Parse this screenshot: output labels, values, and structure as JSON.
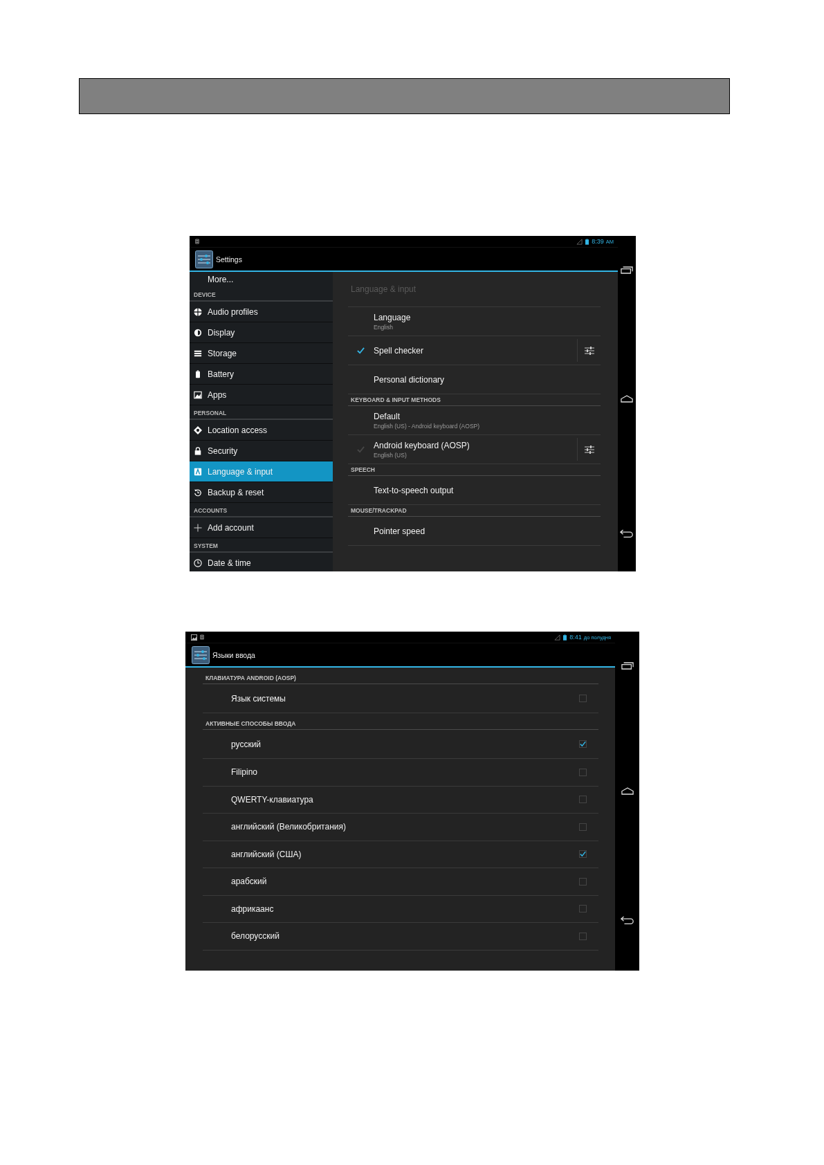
{
  "settings_screen": {
    "status_bar": {
      "time": "8:39",
      "meridiem": "AM"
    },
    "action_bar": {
      "title": "Settings"
    },
    "sidebar": {
      "items": [
        {
          "kind": "item",
          "label": "More...",
          "selected": false
        },
        {
          "kind": "header",
          "label": "DEVICE"
        },
        {
          "kind": "item",
          "label": "Audio profiles",
          "selected": false
        },
        {
          "kind": "item",
          "label": "Display",
          "selected": false
        },
        {
          "kind": "item",
          "label": "Storage",
          "selected": false
        },
        {
          "kind": "item",
          "label": "Battery",
          "selected": false
        },
        {
          "kind": "item",
          "label": "Apps",
          "selected": false
        },
        {
          "kind": "header",
          "label": "PERSONAL"
        },
        {
          "kind": "item",
          "label": "Location access",
          "selected": false
        },
        {
          "kind": "item",
          "label": "Security",
          "selected": false
        },
        {
          "kind": "item",
          "label": "Language & input",
          "selected": true
        },
        {
          "kind": "item",
          "label": "Backup & reset",
          "selected": false
        },
        {
          "kind": "header",
          "label": "ACCOUNTS"
        },
        {
          "kind": "item",
          "label": "Add account",
          "selected": false
        },
        {
          "kind": "header",
          "label": "SYSTEM"
        },
        {
          "kind": "item",
          "label": "Date & time",
          "selected": false
        }
      ]
    },
    "detail": {
      "title": "Language & input",
      "items": [
        {
          "kind": "row",
          "title": "Language",
          "summary": "English"
        },
        {
          "kind": "check",
          "title": "Spell checker",
          "checked": true,
          "disabled": false,
          "settings": true
        },
        {
          "kind": "row",
          "title": "Personal dictionary"
        },
        {
          "kind": "header",
          "title": "KEYBOARD & INPUT METHODS"
        },
        {
          "kind": "row",
          "title": "Default",
          "summary": "English (US) - Android keyboard (AOSP)"
        },
        {
          "kind": "check",
          "title": "Android keyboard (AOSP)",
          "summary": "English (US)",
          "checked": true,
          "disabled": true,
          "settings": true
        },
        {
          "kind": "header",
          "title": "SPEECH"
        },
        {
          "kind": "row",
          "title": "Text-to-speech output"
        },
        {
          "kind": "header",
          "title": "MOUSE/TRACKPAD"
        },
        {
          "kind": "row",
          "title": "Pointer speed"
        }
      ]
    }
  },
  "input_languages_screen": {
    "status_bar": {
      "time": "8:41",
      "meridiem": "до полудня"
    },
    "action_bar": {
      "title": "Языки ввода"
    },
    "items": [
      {
        "kind": "header",
        "title": "КЛАВИАТУРА ANDROID (AOSP)"
      },
      {
        "kind": "check",
        "title": "Язык системы",
        "checked": false
      },
      {
        "kind": "header",
        "title": "АКТИВНЫЕ СПОСОБЫ ВВОДА"
      },
      {
        "kind": "check",
        "title": "русский",
        "checked": true
      },
      {
        "kind": "check",
        "title": "Filipino",
        "checked": false
      },
      {
        "kind": "check",
        "title": "QWERTY-клавиатура",
        "checked": false
      },
      {
        "kind": "check",
        "title": "английский (Великобритания)",
        "checked": false
      },
      {
        "kind": "check",
        "title": "английский (США)",
        "checked": true
      },
      {
        "kind": "check",
        "title": "арабский",
        "checked": false
      },
      {
        "kind": "check",
        "title": "африкаанс",
        "checked": false
      },
      {
        "kind": "check",
        "title": "белорусский",
        "checked": false
      }
    ]
  }
}
